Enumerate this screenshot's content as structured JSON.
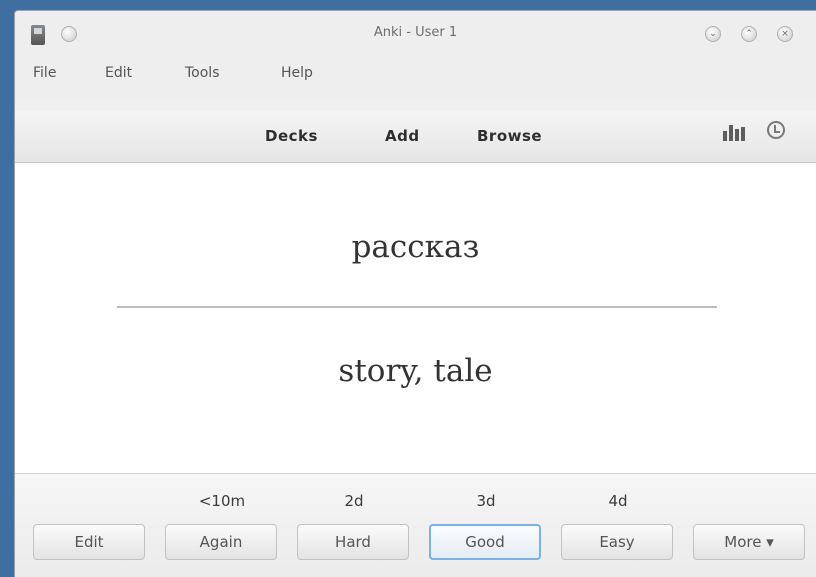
{
  "window": {
    "title": "Anki - User 1",
    "title_buttons": [
      "minimize-icon",
      "restore-icon",
      "close-icon"
    ]
  },
  "menu": [
    "File",
    "Edit",
    "Tools",
    "Help"
  ],
  "toolbar": {
    "links": [
      "Decks",
      "Add",
      "Browse"
    ],
    "icons": [
      "stats-icon",
      "sync-icon"
    ]
  },
  "card": {
    "front": "рассказ",
    "back": "story, tale"
  },
  "answer_bar": {
    "intervals": {
      "again": "<10m",
      "hard": "2d",
      "good": "3d",
      "easy": "4d"
    },
    "buttons": {
      "edit": "Edit",
      "again": "Again",
      "hard": "Hard",
      "good": "Good",
      "easy": "Easy",
      "more": "More ▾"
    },
    "default_button": "Good"
  },
  "colors": {
    "desktop": "#3f6fa0",
    "focus_ring": "#7bb1e3"
  }
}
